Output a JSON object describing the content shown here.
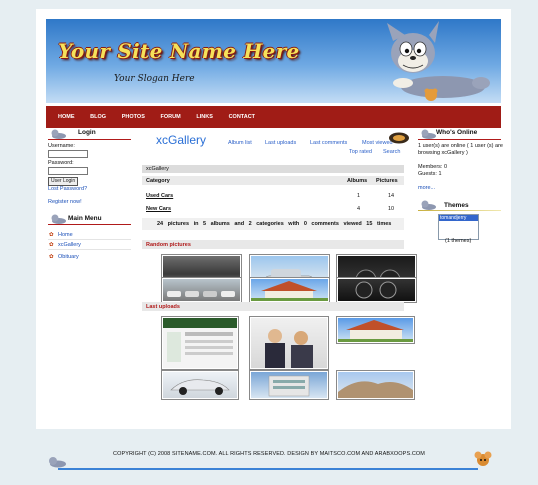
{
  "header": {
    "site_name": "Your Site Name Here",
    "slogan": "Your Slogan Here"
  },
  "nav": {
    "items": [
      "HOME",
      "BLOG",
      "PHOTOS",
      "FORUM",
      "LINKS",
      "CONTACT"
    ]
  },
  "login": {
    "title": "Login",
    "username_label": "Username:",
    "password_label": "Password:",
    "button": "User Login",
    "lost_password": "Lost Password?",
    "register": "Register now!"
  },
  "main_menu": {
    "title": "Main Menu",
    "items": [
      "Home",
      "xcGallery",
      "Obituary"
    ]
  },
  "gallery": {
    "title": "xcGallery",
    "links": [
      "Album list",
      "Last uploads",
      "Last comments",
      "Most viewed",
      "Top rated",
      "Search"
    ],
    "breadcrumb": "xcGallery",
    "columns": [
      "Category",
      "Albums",
      "Pictures"
    ],
    "rows": [
      {
        "category": "Used Cars",
        "albums": "1",
        "pictures": "14"
      },
      {
        "category": "New Cars",
        "albums": "4",
        "pictures": "10"
      }
    ],
    "stats": "24 pictures in 5 albums and 2 categories with 0 comments viewed 15 times",
    "random_title": "Random pictures",
    "last_title": "Last uploads"
  },
  "whos_online": {
    "title": "Who's Online",
    "text": "1 user(s) are online ( 1 user (s) are browsing xcGallery )",
    "members": "Members: 0",
    "guests": "Guests: 1",
    "more": "more..."
  },
  "themes": {
    "title": "Themes",
    "selected": "tomandjerry",
    "count": "(1 themes)"
  },
  "footer": {
    "text": "COPYRIGHT (C) 2008 SITENAME.COM. ALL RIGHTS RESERVED. DESIGN BY MAITSCO.COM AND ARABXOOPS.COM"
  },
  "colors": {
    "nav_bg": "#a01c16",
    "accent_red": "#b01a1a",
    "link_blue": "#2a5fc8",
    "title_blue": "#2a6fd6"
  }
}
